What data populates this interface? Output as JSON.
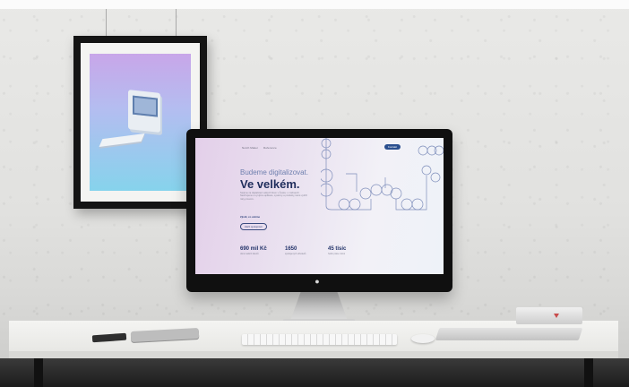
{
  "poster": {},
  "monitor_site": {
    "nav_brand": "Notch Maker",
    "nav_link": "Reference",
    "contact_button": "Kontakt",
    "hero_subtitle": "Budeme digitalizovat.",
    "hero_title": "Ve velkém.",
    "hero_paragraph": "Stojíme za digitalizací velkých firem v Česku i v zahraničí. Navrhujeme a vyvíjíme aplikace, systémy a produkty, které vydrží roky provozu.",
    "hero_link": "Zjistit, co umíme",
    "hero_button": "Začít spolupráci",
    "stats": [
      {
        "value": "690 mil Kč",
        "label": "obrat našich klientů"
      },
      {
        "value": "1650",
        "label": "spokojených uživatelů"
      },
      {
        "value": "45 tisíc",
        "label": "hodin práce ročně"
      }
    ]
  },
  "colors": {
    "wall": "#e5e5e3",
    "frame": "#141414",
    "poster_gradient_top": "#c8a6e9",
    "poster_gradient_bottom": "#86d3ec",
    "site_accent": "#2b4f8f",
    "site_title": "#1f2d5c"
  }
}
